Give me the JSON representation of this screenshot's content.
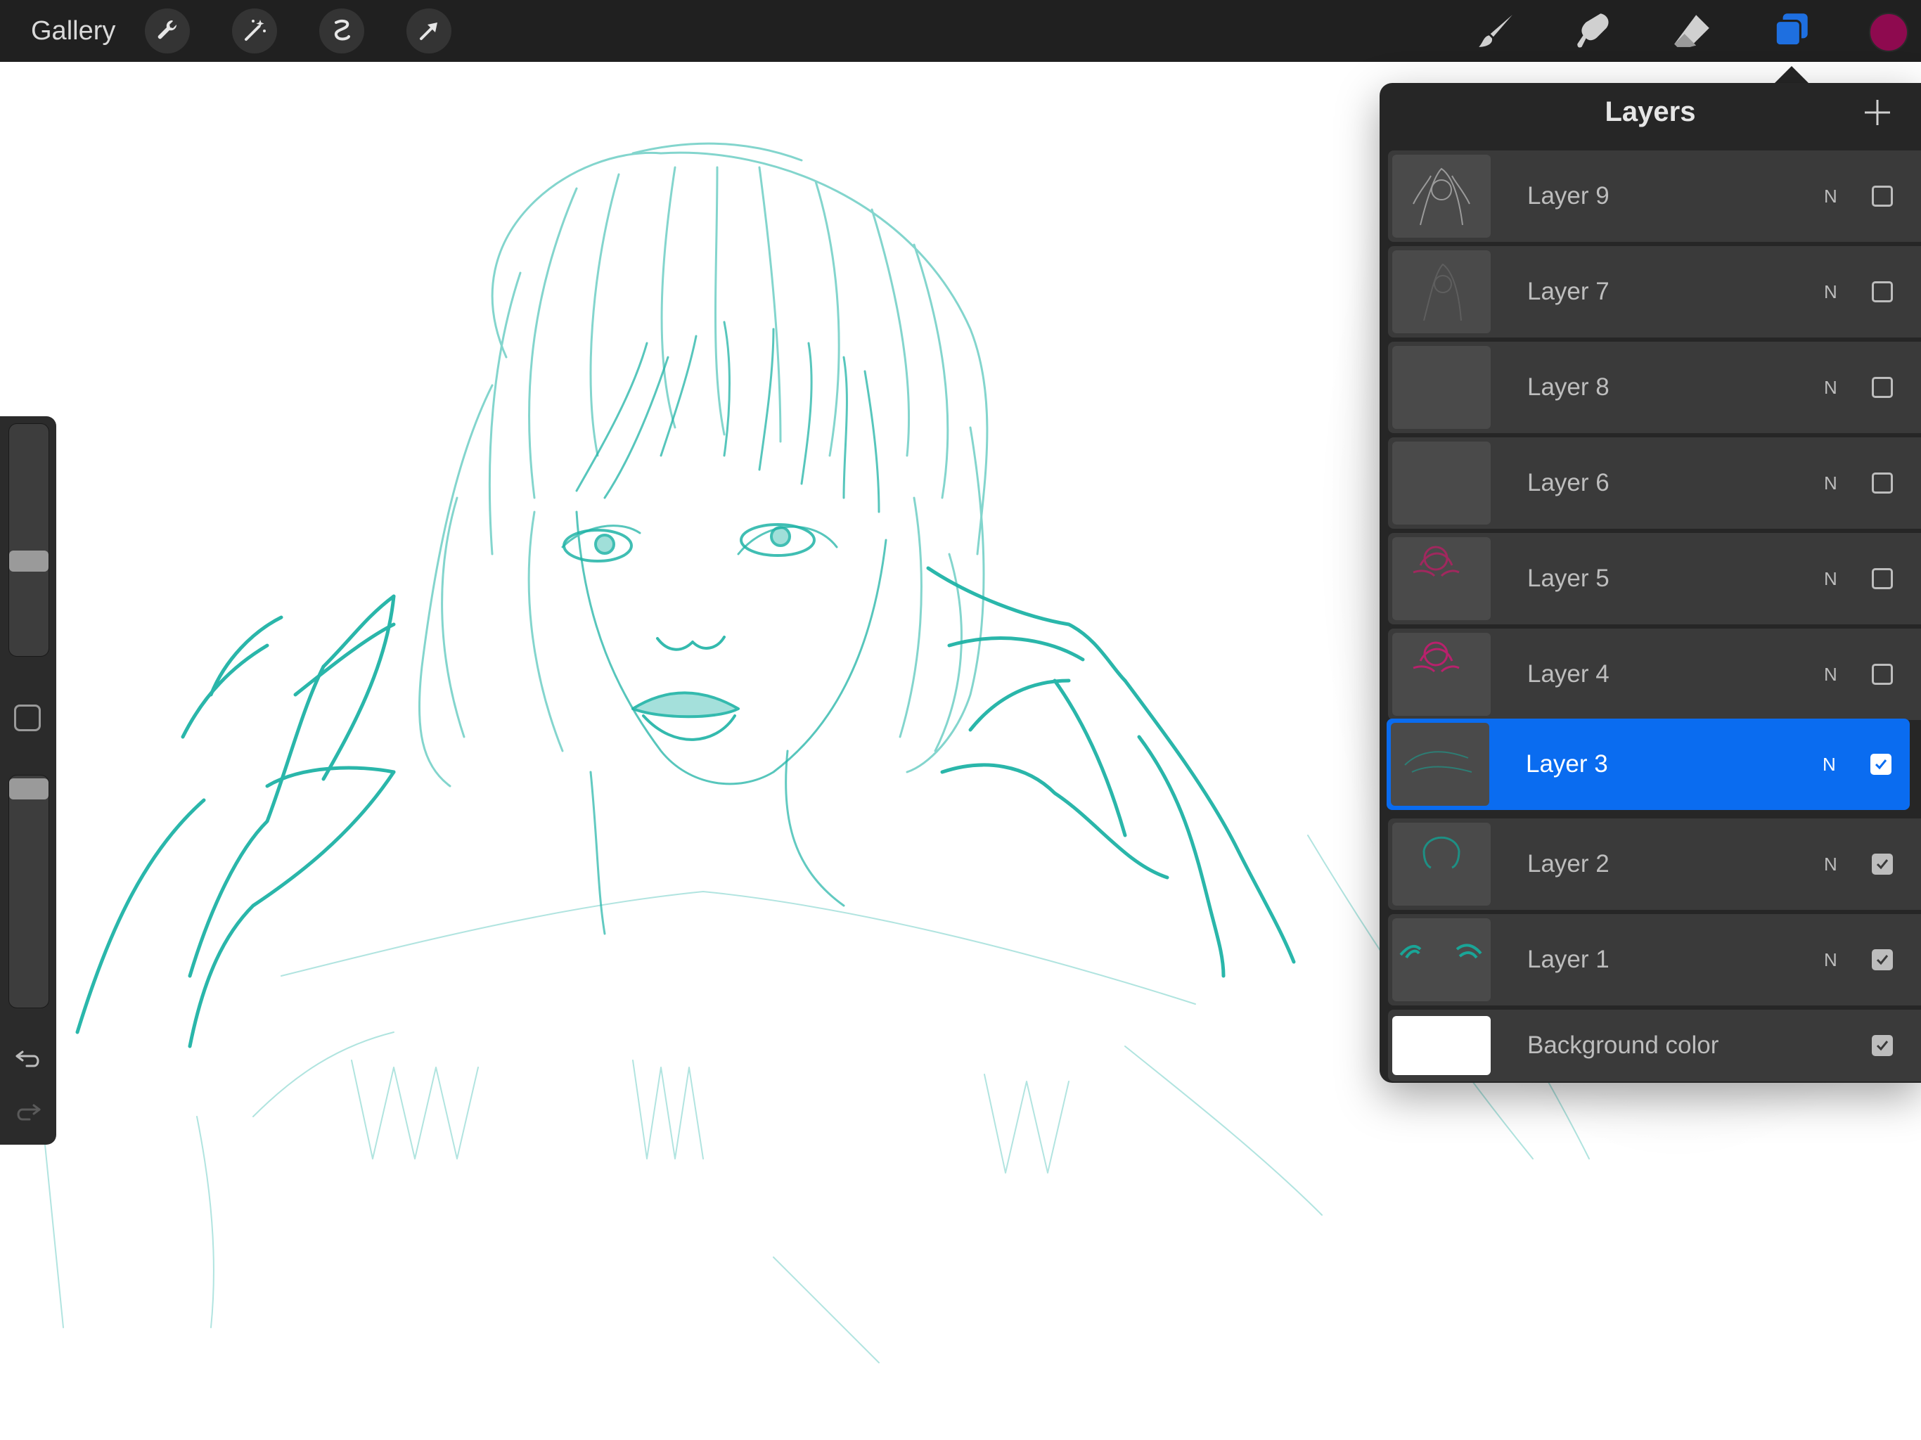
{
  "toolbar": {
    "gallery_label": "Gallery",
    "left_tools": [
      {
        "name": "wrench-icon",
        "label": "Actions"
      },
      {
        "name": "magic-wand-icon",
        "label": "Adjustments"
      },
      {
        "name": "selection-icon",
        "label": "Selection"
      },
      {
        "name": "transform-arrow-icon",
        "label": "Transform"
      }
    ],
    "right_tools": [
      {
        "name": "brush-icon",
        "label": "Paint"
      },
      {
        "name": "smudge-icon",
        "label": "Smudge"
      },
      {
        "name": "eraser-icon",
        "label": "Erase"
      },
      {
        "name": "layers-icon",
        "label": "Layers",
        "active": true
      }
    ],
    "active_tool_color": "#1e6fe0",
    "current_color": "#8e0a4f"
  },
  "sidebar": {
    "brush_size_level": 0.58,
    "opacity_level": 0.98,
    "undo_icon": "undo-icon",
    "redo_icon": "redo-icon"
  },
  "layers_panel": {
    "title": "Layers",
    "add_icon": "plus-icon",
    "layers": [
      {
        "name": "Layer 9",
        "mode": "N",
        "visible": false,
        "selected": false,
        "thumb": "gray-sketch"
      },
      {
        "name": "Layer 7",
        "mode": "N",
        "visible": false,
        "selected": false,
        "thumb": "dark-sketch"
      },
      {
        "name": "Layer 8",
        "mode": "N",
        "visible": false,
        "selected": false,
        "thumb": "empty"
      },
      {
        "name": "Layer 6",
        "mode": "N",
        "visible": false,
        "selected": false,
        "thumb": "empty"
      },
      {
        "name": "Layer 5",
        "mode": "N",
        "visible": false,
        "selected": false,
        "thumb": "magenta-sketch"
      },
      {
        "name": "Layer 4",
        "mode": "N",
        "visible": false,
        "selected": false,
        "thumb": "magenta-sketch"
      },
      {
        "name": "Layer 3",
        "mode": "N",
        "visible": true,
        "selected": true,
        "thumb": "teal-faint"
      },
      {
        "name": "Layer 2",
        "mode": "N",
        "visible": true,
        "selected": false,
        "thumb": "teal-hair"
      },
      {
        "name": "Layer 1",
        "mode": "N",
        "visible": true,
        "selected": false,
        "thumb": "teal-hands"
      },
      {
        "name": "Background color",
        "mode": "",
        "visible": true,
        "selected": false,
        "thumb": "white"
      }
    ]
  },
  "colors": {
    "sketch_teal": "#1fb3a6",
    "panel_bg": "#262626",
    "row_bg": "#3a3a3a",
    "selected_row": "#0a6cf0"
  }
}
